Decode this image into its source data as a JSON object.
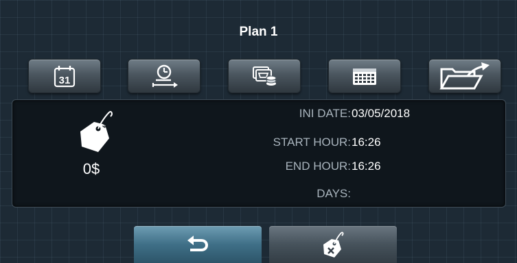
{
  "header": {
    "title": "Plan 1"
  },
  "toolbar": {
    "buttons": [
      {
        "icon": "calendar-day-icon",
        "text": "31"
      },
      {
        "icon": "time-range-icon"
      },
      {
        "icon": "price-list-icon"
      },
      {
        "icon": "calendar-grid-icon"
      },
      {
        "icon": "export-folder-icon"
      }
    ]
  },
  "details": {
    "price_icon": "price-tag-icon",
    "price": "0$",
    "ini_date_label": "INI DATE:",
    "ini_date_value": "03/05/2018",
    "start_hour_label": "START HOUR:",
    "start_hour_value": "16:26",
    "end_hour_label": "END HOUR:",
    "end_hour_value": "16:26",
    "days_label": "DAYS:",
    "days_value": ""
  },
  "footer": {
    "back_icon": "back-arrow-icon",
    "delete_icon": "delete-price-tag-icon"
  },
  "colors": {
    "background": "#1d2a35",
    "panel": "#0f161c",
    "label": "#a9b4bd",
    "value": "#ffffff",
    "back_button": "#3f6f87",
    "button": "#4b565f"
  }
}
